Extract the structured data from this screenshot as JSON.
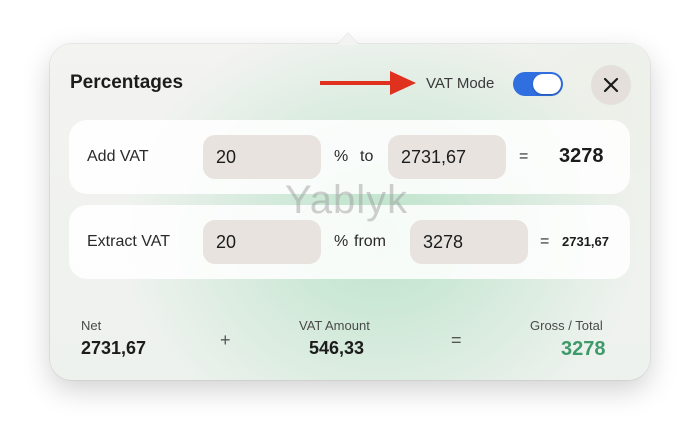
{
  "header": {
    "title": "Percentages",
    "vat_mode_label": "VAT Mode",
    "vat_mode_on": true,
    "close_icon": "close-icon"
  },
  "add_vat": {
    "label": "Add VAT",
    "percent": "20",
    "percent_symbol": "%",
    "connector": "to",
    "amount": "2731,67",
    "equals": "=",
    "result": "3278"
  },
  "extract_vat": {
    "label": "Extract VAT",
    "percent": "20",
    "percent_symbol": "%",
    "connector": "from",
    "amount": "3278",
    "equals": "=",
    "result": "2731,67"
  },
  "summary": {
    "net_label": "Net",
    "net_value": "2731,67",
    "plus": "+",
    "vat_label": "VAT Amount",
    "vat_value": "546,33",
    "equals": "=",
    "gross_label": "Gross / Total",
    "gross_value": "3278"
  },
  "watermark": "Yablyk",
  "colors": {
    "toggle_on": "#2f6fe0",
    "annotation_arrow": "#e0301e",
    "gross_accent": "#3f9a6a"
  }
}
